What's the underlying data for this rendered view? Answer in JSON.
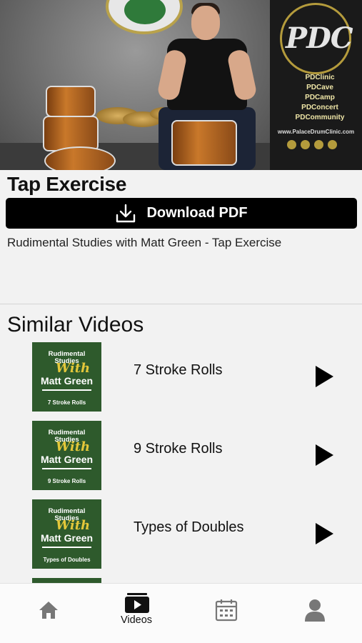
{
  "video": {
    "banner_title": "PDC",
    "banner_menu": [
      "PDClinic",
      "PDCave",
      "PDCamp",
      "PDConcert",
      "PDCommunity"
    ],
    "banner_url": "www.PalaceDrumClinic.com"
  },
  "page": {
    "title": "Tap Exercise",
    "download_label": "Download PDF",
    "subtitle": "Rudimental Studies with Matt Green - Tap Exercise",
    "section_title": "Similar Videos"
  },
  "thumbnail": {
    "line1": "Rudimental",
    "line2": "Studies",
    "with": "With",
    "name": "Matt Green"
  },
  "similar_videos": [
    {
      "title": "7 Stroke Rolls",
      "thumb_caption": "7 Stroke Rolls",
      "icon": "play-icon"
    },
    {
      "title": "9 Stroke Rolls",
      "thumb_caption": "9 Stroke Rolls",
      "icon": "play-icon"
    },
    {
      "title": "Types of Doubles",
      "thumb_caption": "Types of Doubles",
      "icon": "play-icon"
    }
  ],
  "tabbar": {
    "tabs": [
      {
        "icon": "home-icon",
        "label": ""
      },
      {
        "icon": "videos-icon",
        "label": "Videos"
      },
      {
        "icon": "calendar-icon",
        "label": ""
      },
      {
        "icon": "profile-icon",
        "label": ""
      }
    ]
  },
  "colors": {
    "accent": "#000000",
    "thumb_bg": "#2e5a2c",
    "thumb_with": "#e3c73a",
    "tab_icon": "#777777"
  }
}
